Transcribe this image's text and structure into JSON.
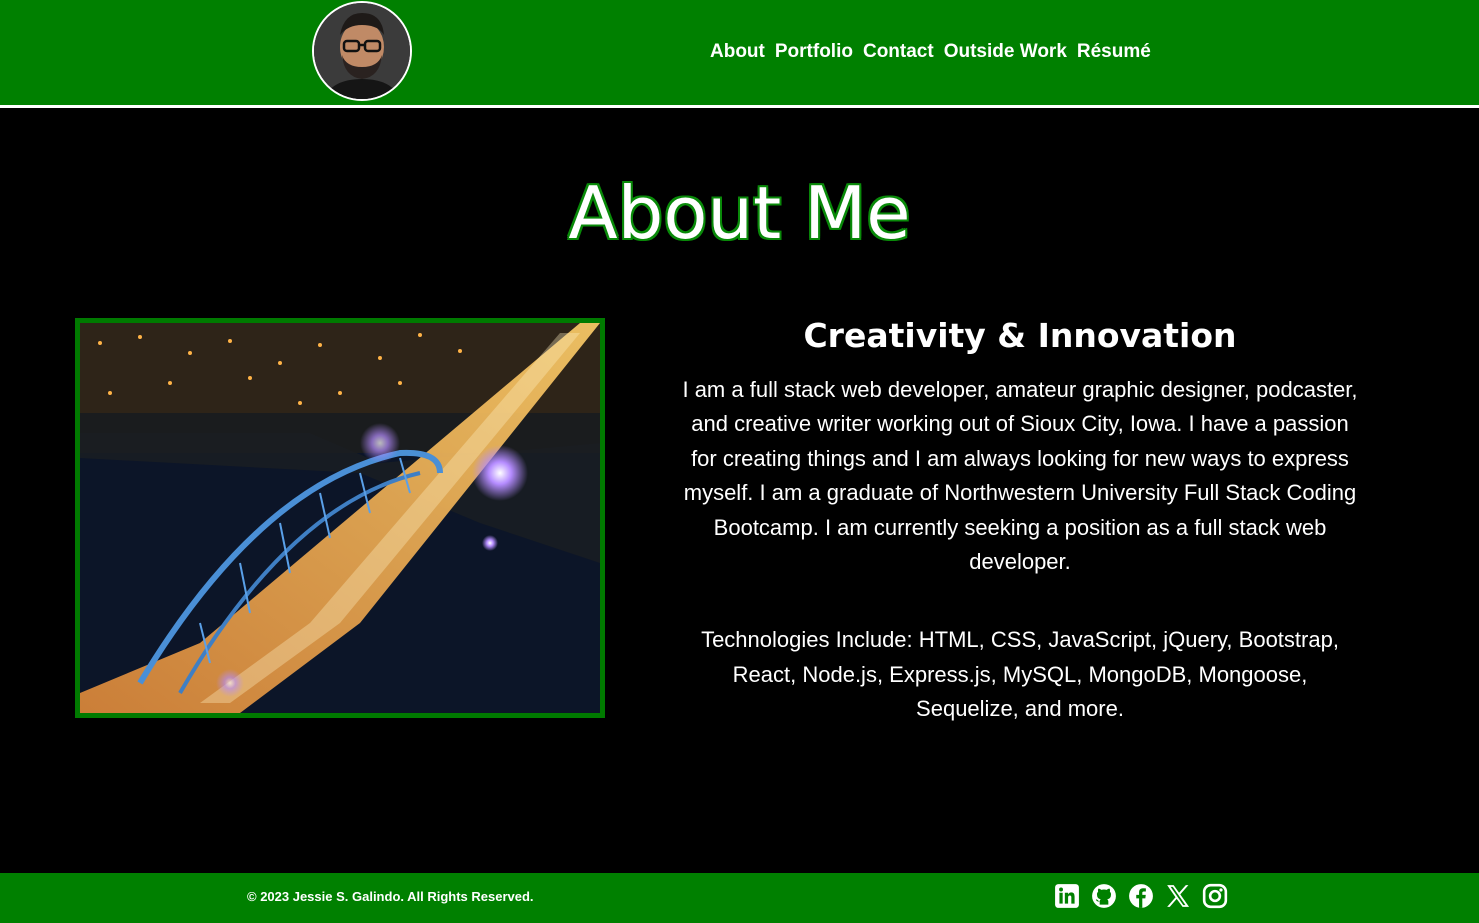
{
  "header": {
    "nav": [
      {
        "label": "About"
      },
      {
        "label": "Portfolio"
      },
      {
        "label": "Contact"
      },
      {
        "label": "Outside Work"
      },
      {
        "label": "Résumé"
      }
    ]
  },
  "main": {
    "title": "About Me",
    "subtitle": "Creativity & Innovation",
    "bio": "I am a full stack web developer, amateur graphic designer, podcaster, and creative writer working out of Sioux City, Iowa. I have a passion for creating things and I am always looking for new ways to express myself. I am a graduate of Northwestern University Full Stack Coding Bootcamp. I am currently seeking a position as a full stack web developer.",
    "technologies": "Technologies Include: HTML, CSS, JavaScript, jQuery, Bootstrap, React, Node.js, Express.js, MySQL, MongoDB, Mongoose, Sequelize, and more."
  },
  "footer": {
    "copyright": "© 2023 Jessie S. Galindo. All Rights Reserved.",
    "social_icons": [
      "linkedin-icon",
      "github-icon",
      "facebook-icon",
      "x-icon",
      "instagram-icon"
    ]
  },
  "colors": {
    "brand_green": "#008000",
    "background": "#000000",
    "text": "#ffffff"
  }
}
